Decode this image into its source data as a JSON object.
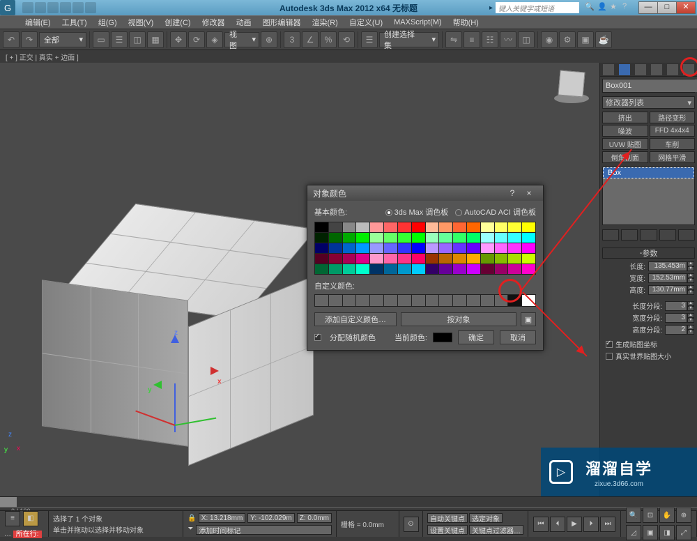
{
  "window": {
    "title": "Autodesk 3ds Max 2012 x64   无标题",
    "search_placeholder": "键入关键字或短语"
  },
  "menu": [
    "编辑(E)",
    "工具(T)",
    "组(G)",
    "视图(V)",
    "创建(C)",
    "修改器",
    "动画",
    "图形编辑器",
    "渲染(R)",
    "自定义(U)",
    "MAXScript(M)",
    "帮助(H)"
  ],
  "toolbar": {
    "combo_all": "全部",
    "view_label": "视图",
    "selset": "创建选择集"
  },
  "infobar": "[ + ] 正交 | 真实 + 边面 ]",
  "dialog": {
    "title": "对象颜色",
    "basic_label": "基本颜色:",
    "palette1_label": "3ds Max 调色板",
    "palette2_label": "AutoCAD ACI 调色板",
    "custom_label": "自定义颜色:",
    "add_custom": "添加自定义颜色…",
    "by_object": "按对象",
    "assign_random": "分配随机颜色",
    "current_label": "当前颜色:",
    "ok": "确定",
    "cancel": "取消",
    "help_btn": "?",
    "close_btn": "×"
  },
  "panel": {
    "obj_name": "Box001",
    "modlist_label": "修改器列表",
    "mod_buttons": [
      "挤出",
      "路径变形",
      "噪波",
      "FFD 4x4x4",
      "UVW 贴图",
      "车削",
      "倒角剖面",
      "网格平滑"
    ],
    "stack_item": "Box",
    "rollout_params": "参数",
    "params": {
      "length_lbl": "长度:",
      "length_val": "135.453m",
      "width_lbl": "宽度:",
      "width_val": "152.53mm",
      "height_lbl": "高度:",
      "height_val": "130.77mm",
      "lseg_lbl": "长度分段:",
      "lseg_val": "3",
      "wseg_lbl": "宽度分段:",
      "wseg_val": "3",
      "hseg_lbl": "高度分段:",
      "hseg_val": "2",
      "gen_uv": "生成贴图坐标",
      "real_world": "真实世界贴图大小"
    }
  },
  "timeline": {
    "label": "0 / 100"
  },
  "status": {
    "sel": "选择了 1 个对象",
    "hint": "单击并拖动以选择并移动对象",
    "x": "X: 13.218mm",
    "y": "Y: -102.029m",
    "z": "Z: 0.0mm",
    "grid": "栅格 = 0.0mm",
    "autokey": "自动关键点",
    "selkey": "选定对象",
    "addtime": "添加时间标记",
    "setkey": "设置关键点",
    "filter": "关键点过滤器…",
    "current": "所在行:"
  },
  "watermark": {
    "brand": "溜溜自学",
    "url": "zixue.3d66.com"
  },
  "palette_colors": [
    "#000",
    "#444",
    "#888",
    "#bbb",
    "#f99",
    "#f66",
    "#f33",
    "#f00",
    "#fb9",
    "#f96",
    "#f63",
    "#f60",
    "#ff9",
    "#ff6",
    "#ff3",
    "#ff0",
    "#020",
    "#060",
    "#0a0",
    "#0e0",
    "#9f9",
    "#6f6",
    "#3f3",
    "#0f0",
    "#9fb",
    "#6f9",
    "#3f6",
    "#0f6",
    "#9ff",
    "#6ff",
    "#3ff",
    "#0ff",
    "#006",
    "#039",
    "#06c",
    "#09f",
    "#99f",
    "#66f",
    "#33f",
    "#00f",
    "#b9f",
    "#96f",
    "#63f",
    "#60f",
    "#f9f",
    "#f6f",
    "#f3f",
    "#f0f",
    "#502",
    "#803",
    "#a05",
    "#d08",
    "#f9c",
    "#f6a",
    "#f38",
    "#f06",
    "#930",
    "#b60",
    "#d80",
    "#fa0",
    "#690",
    "#8b0",
    "#ad0",
    "#cf0",
    "#063",
    "#096",
    "#0c9",
    "#0fc",
    "#036",
    "#069",
    "#09c",
    "#0cf",
    "#306",
    "#609",
    "#90c",
    "#c0f",
    "#603",
    "#906",
    "#c09",
    "#f0c"
  ]
}
